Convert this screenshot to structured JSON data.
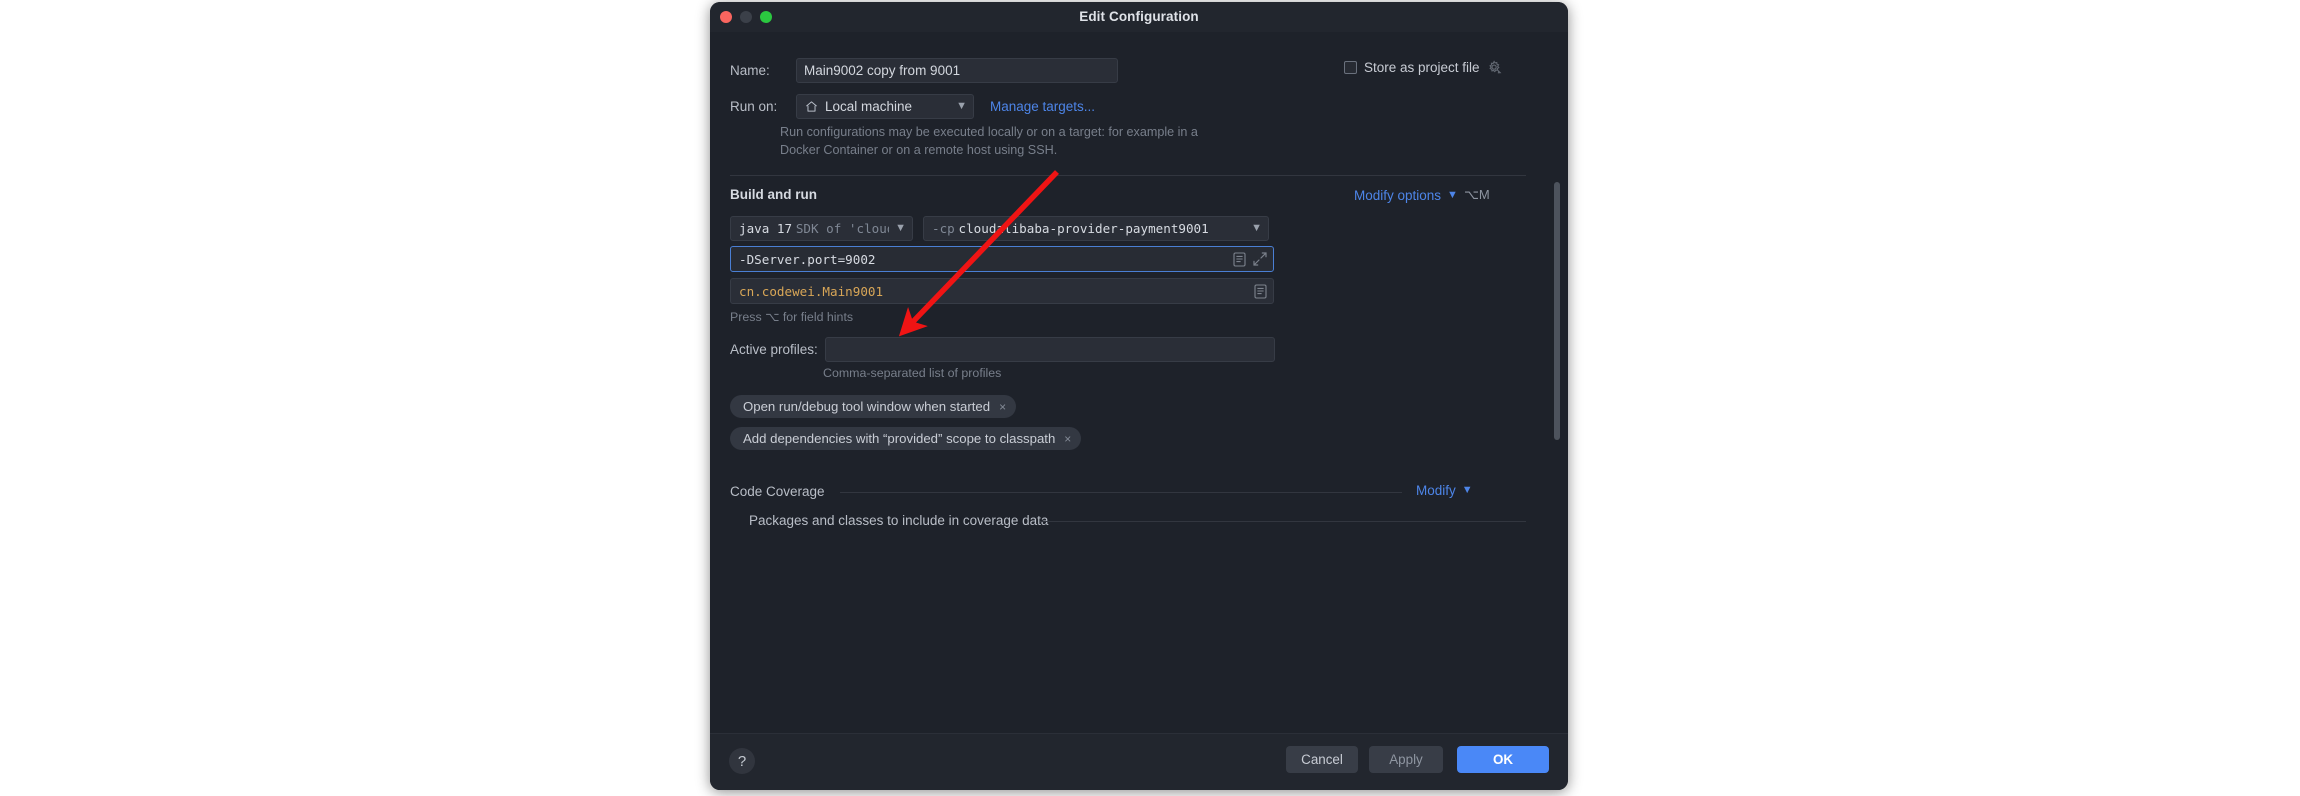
{
  "window": {
    "title": "Edit Configuration",
    "traffic_lights": [
      "close-red",
      "minimize-gray",
      "zoom-green"
    ]
  },
  "form": {
    "name_label": "Name:",
    "name_value": "Main9002 copy from 9001",
    "store_as_project_file_label": "Store as project file",
    "store_as_project_file_checked": false,
    "run_on_label": "Run on:",
    "run_on_value": "Local machine",
    "manage_targets_link": "Manage targets...",
    "run_on_hint": "Run configurations may be executed locally or on a target: for example in a Docker Container or on a remote host using SSH."
  },
  "build_and_run": {
    "section_title": "Build and run",
    "modify_options_label": "Modify options",
    "modify_options_shortcut": "⌥M",
    "jdk_prefix": "java 17",
    "jdk_suffix": "SDK of 'cloudal",
    "classpath_prefix": "-cp",
    "classpath_value": "cloudalibaba-provider-payment9001",
    "vm_options_value": "-DServer.port=9002",
    "main_class_value": "cn.codewei.Main9001",
    "field_hint": "Press ⌥ for field hints",
    "active_profiles_label": "Active profiles:",
    "active_profiles_value": "",
    "active_profiles_hint": "Comma-separated list of profiles",
    "chips": [
      {
        "label": "Open run/debug tool window when started",
        "remove": "×"
      },
      {
        "label": "Add dependencies with “provided” scope to classpath",
        "remove": "×"
      }
    ]
  },
  "code_coverage": {
    "section_title": "Code Coverage",
    "modify_label": "Modify",
    "packages_title": "Packages and classes to include in coverage data"
  },
  "footer": {
    "help_label": "?",
    "cancel_label": "Cancel",
    "apply_label": "Apply",
    "ok_label": "OK"
  },
  "colors": {
    "accent_blue": "#4a88f7",
    "link_blue": "#4d85e8",
    "focus_border": "#4a7fd4",
    "main_class_text": "#d8a657",
    "annotation_red": "#f01414",
    "window_bg": "#1e222a",
    "titlebar_bg": "#22262e"
  }
}
